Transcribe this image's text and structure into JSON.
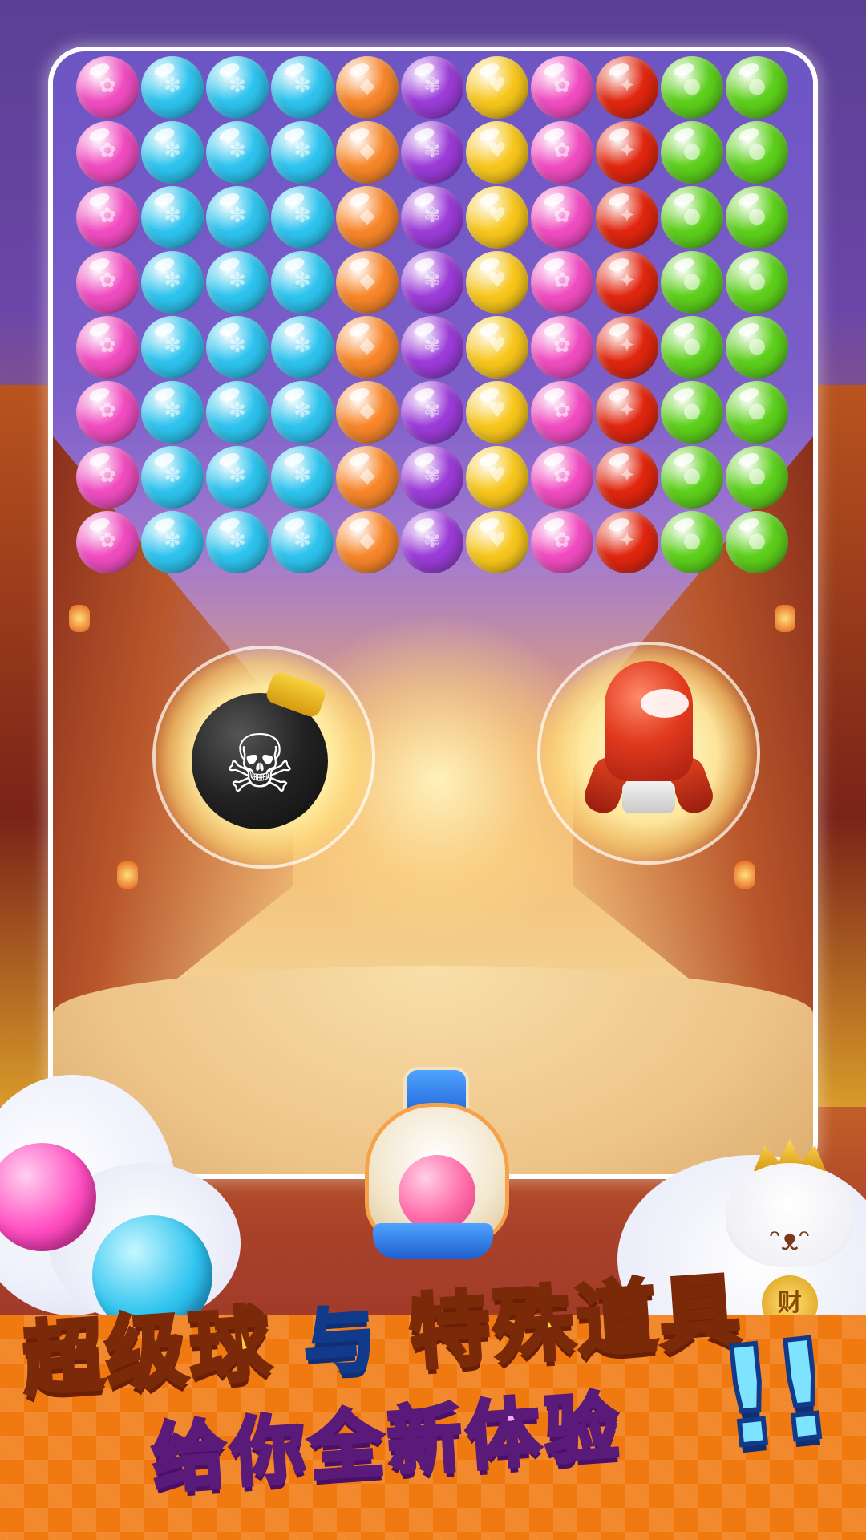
{
  "headline": {
    "part1": "超级球",
    "connector": "与",
    "part2": "特殊道具",
    "line2": "给你全新体验",
    "exclaim": "!!"
  },
  "bubble_columns": [
    "pink",
    "cyan",
    "cyan",
    "cyan",
    "orange",
    "purple",
    "yellow",
    "pink",
    "red",
    "green",
    "green"
  ],
  "bubble_rows": 8,
  "colors": {
    "pink": "#f04cc0",
    "cyan": "#2ec3ee",
    "orange": "#f7862a",
    "purple": "#9b3cd8",
    "yellow": "#f7c61c",
    "red": "#e0260f",
    "green": "#5dcf1c"
  },
  "powerups": [
    "bomb",
    "rocket"
  ],
  "launcher": {
    "loaded_bubble": "pink"
  },
  "mascot": {
    "coin_text": "财"
  }
}
